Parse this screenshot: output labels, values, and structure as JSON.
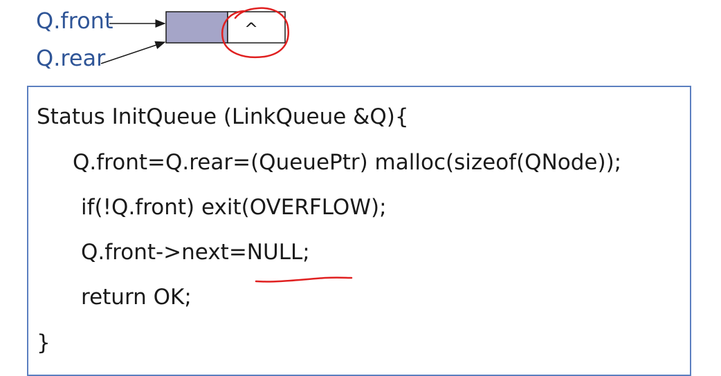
{
  "diagram": {
    "front_label": "Q.front",
    "rear_label": "Q.rear",
    "null_symbol": "^",
    "node_data_fill": "#a5a5c8",
    "label_color": "#2f5597"
  },
  "code": {
    "lines": [
      "Status InitQueue (LinkQueue &Q){",
      "Q.front=Q.rear=(QueuePtr) malloc(sizeof(QNode));",
      "if(!Q.front) exit(OVERFLOW);",
      "Q.front->next=NULL;",
      "return OK;",
      "}"
    ],
    "border_color": "#5b7fc0"
  },
  "annotations": {
    "pen_color": "#e02020"
  }
}
